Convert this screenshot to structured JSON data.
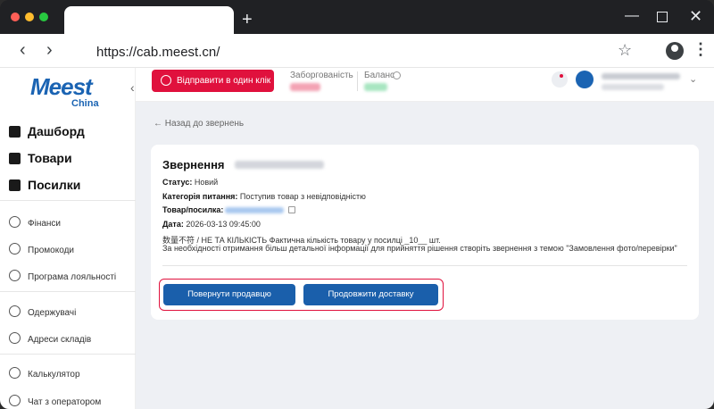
{
  "browser": {
    "url": "https://cab.meest.cn/"
  },
  "brand": {
    "logo_text": "Meest",
    "logo_sub": "China",
    "primary_color": "#1b64b3",
    "accent_color": "#e0113d"
  },
  "sidebar": {
    "main_items": [
      {
        "label": "Дашборд",
        "icon": "dashboard-icon"
      },
      {
        "label": "Товари",
        "icon": "box-icon"
      },
      {
        "label": "Посилки",
        "icon": "package-icon"
      }
    ],
    "sub_items": [
      {
        "label": "Фінанси",
        "icon": "wallet-icon"
      },
      {
        "label": "Промокоди",
        "icon": "percent-icon"
      },
      {
        "label": "Програма лояльності",
        "icon": "loyalty-icon"
      },
      {
        "label": "Одержувачі",
        "icon": "recipients-icon"
      },
      {
        "label": "Адреси складів",
        "icon": "location-icon"
      },
      {
        "label": "Калькулятор",
        "icon": "calculator-icon"
      },
      {
        "label": "Чат з оператором",
        "icon": "chat-icon"
      }
    ]
  },
  "header": {
    "send_button": "Відправити в один клік",
    "debt_label": "Заборгованість",
    "balance_label": "Баланс",
    "debt_color": "#e0113d",
    "balance_color": "#2ecc71"
  },
  "main": {
    "back_link": "Назад до звернень",
    "title": "Звернення",
    "fields": {
      "status_label": "Статус:",
      "status_value": "Новий",
      "category_label": "Категорія питання:",
      "category_value": "Поступив товар з невідповідністю",
      "item_label": "Товар/посилка:",
      "date_label": "Дата:",
      "date_value": "2026-03-13 09:45:00"
    },
    "message_line1": "数量不符 / НЕ ТА КІЛЬКІСТЬ Фактична кількість товару у посилці _10__ шт.",
    "message_line2": "За необхідності отримання більш детальної інформації для прийняття рішення створіть звернення з темою \"Замовлення фото/перевірки\"",
    "button_return": "Повернути продавцю",
    "button_continue": "Продовжити доставку"
  }
}
